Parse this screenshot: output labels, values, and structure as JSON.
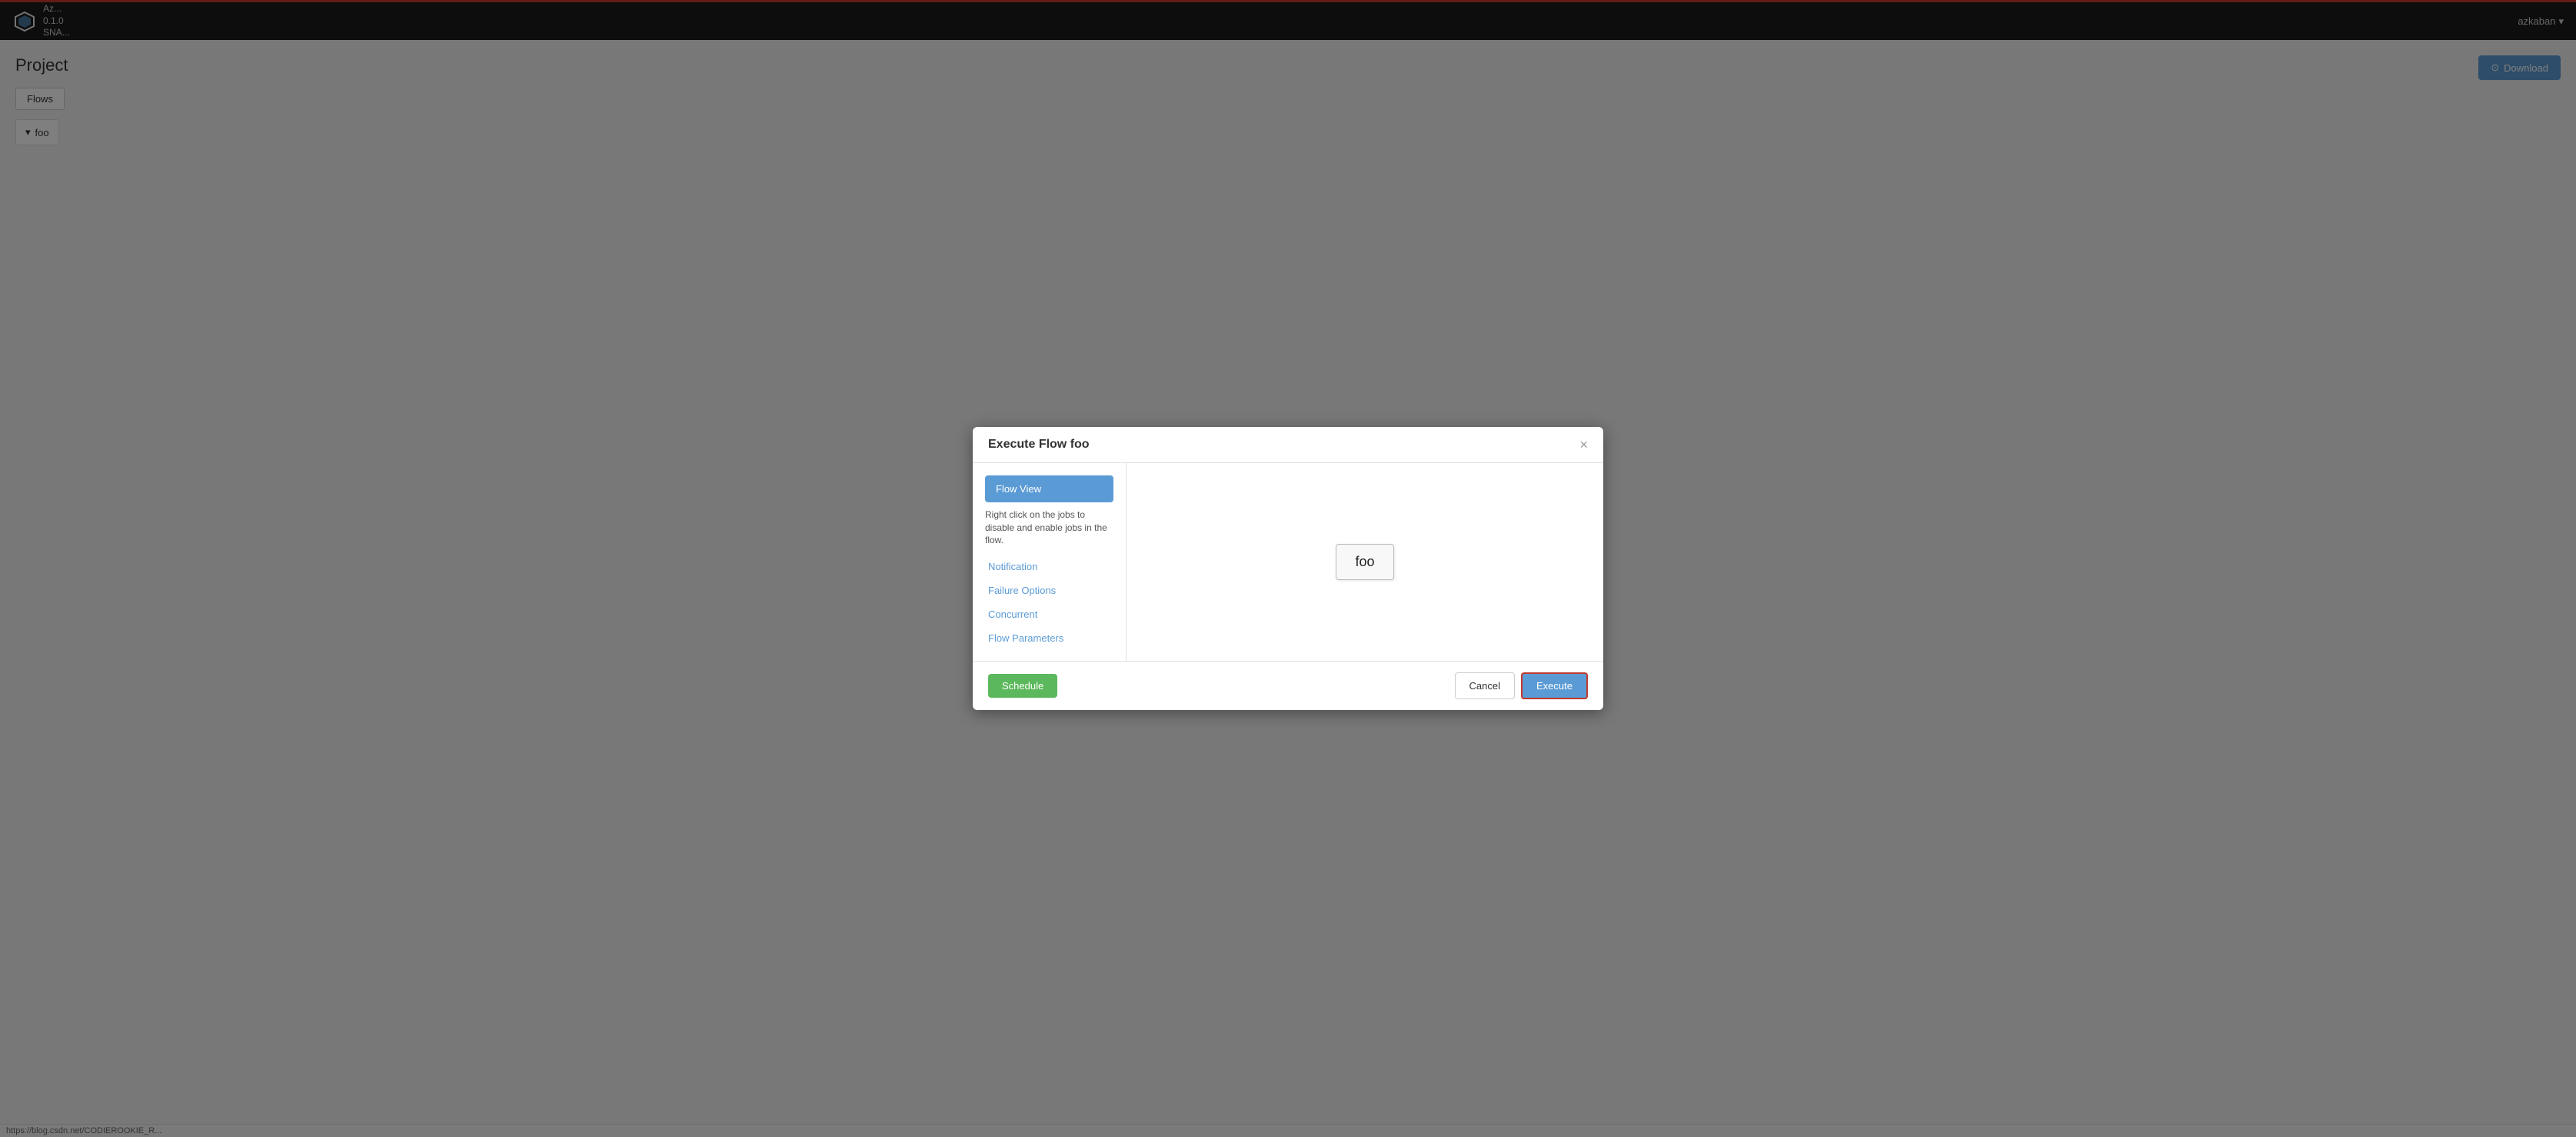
{
  "nav": {
    "logo_text": "Az...",
    "version": "0.1.0",
    "snapshot_label": "SNA...",
    "user": "azkaban",
    "dropdown_icon": "▾"
  },
  "page": {
    "title": "Project",
    "download_label": "Download",
    "download_icon": "⊙"
  },
  "tabs": {
    "flows_label": "Flows"
  },
  "flows_list": {
    "arrow": "▾",
    "flow_name": "foo"
  },
  "modal": {
    "title": "Execute Flow foo",
    "close_icon": "×",
    "flow_view_label": "Flow View",
    "hint": "Right click on the jobs to disable and enable jobs in the flow.",
    "notification_label": "Notification",
    "failure_options_label": "Failure Options",
    "concurrent_label": "Concurrent",
    "flow_parameters_label": "Flow Parameters",
    "flow_node_label": "foo",
    "schedule_label": "Schedule",
    "cancel_label": "Cancel",
    "execute_label": "Execute"
  },
  "status_bar": {
    "url": "https://blog.csdn.net/CODIEROOKIE_R..."
  }
}
